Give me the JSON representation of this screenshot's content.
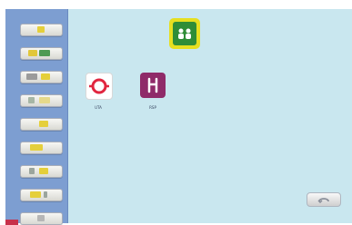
{
  "apps": [
    {
      "label": "UTA",
      "icon": "red-ring-icon"
    },
    {
      "label": "RSP",
      "icon": "utensil-icon"
    }
  ],
  "colors": {
    "sidebar": "#7d9ed1",
    "main": "#c9e7ef",
    "accent": "#c7314b",
    "group_icon_bg": "#e6df20",
    "group_icon_inner": "#2f8d37",
    "app_b_bg": "#8f2b69"
  }
}
